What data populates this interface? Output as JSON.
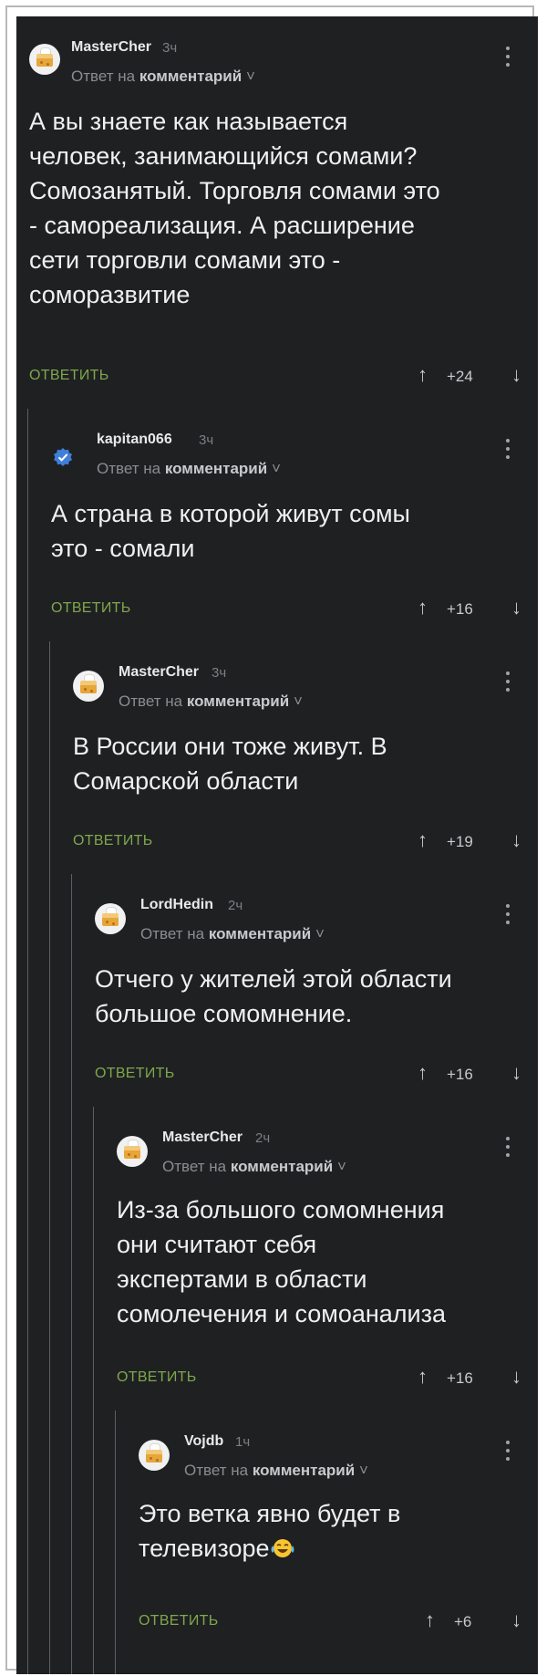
{
  "comments": [
    {
      "username": "MasterCher",
      "time": "3ч",
      "reply_prefix": "Ответ на",
      "reply_target": "комментарий",
      "text": "А вы знаете как называется\nчеловек, занимающийся сомами?\nСомозанятый. Торговля сомами это\n- самореализация. А расширение\nсети торговли сомами это -\nсоморазвитие",
      "reply_label": "ОТВЕТИТЬ",
      "rating": "+24"
    },
    {
      "username": "kapitan066",
      "time": "3ч",
      "reply_prefix": "Ответ на",
      "reply_target": "комментарий",
      "text": "А страна в которой живут сомы\nэто - сомали",
      "reply_label": "ОТВЕТИТЬ",
      "rating": "+16"
    },
    {
      "username": "MasterCher",
      "time": "3ч",
      "reply_prefix": "Ответ на",
      "reply_target": "комментарий",
      "text": "В России они тоже живут. В\nСомарской области",
      "reply_label": "ОТВЕТИТЬ",
      "rating": "+19"
    },
    {
      "username": "LordHedin",
      "time": "2ч",
      "reply_prefix": "Ответ на",
      "reply_target": "комментарий",
      "text": "Отчего у жителей этой области\nбольшое сомомнение.",
      "reply_label": "ОТВЕТИТЬ",
      "rating": "+16"
    },
    {
      "username": "MasterCher",
      "time": "2ч",
      "reply_prefix": "Ответ на",
      "reply_target": "комментарий",
      "text": "Из-за большого сомомнения\nони считают себя\nэкспертами в области\nсомолечения и сомоанализа",
      "reply_label": "ОТВЕТИТЬ",
      "rating": "+16"
    },
    {
      "username": "Vojdb",
      "time": "1ч",
      "reply_prefix": "Ответ на",
      "reply_target": "комментарий",
      "text": "Это ветка явно будет в\nтелевизоре",
      "reply_label": "ОТВЕТИТЬ",
      "rating": "+6"
    }
  ],
  "icons": {
    "vote_up": "↑",
    "vote_down": "↓",
    "chevron": "˅",
    "emoji": "laughing-tears-emoji"
  },
  "colors": {
    "background": "#1f2022",
    "reply_green": "#7fa74c",
    "verified_blue": "#3f7fd9"
  }
}
